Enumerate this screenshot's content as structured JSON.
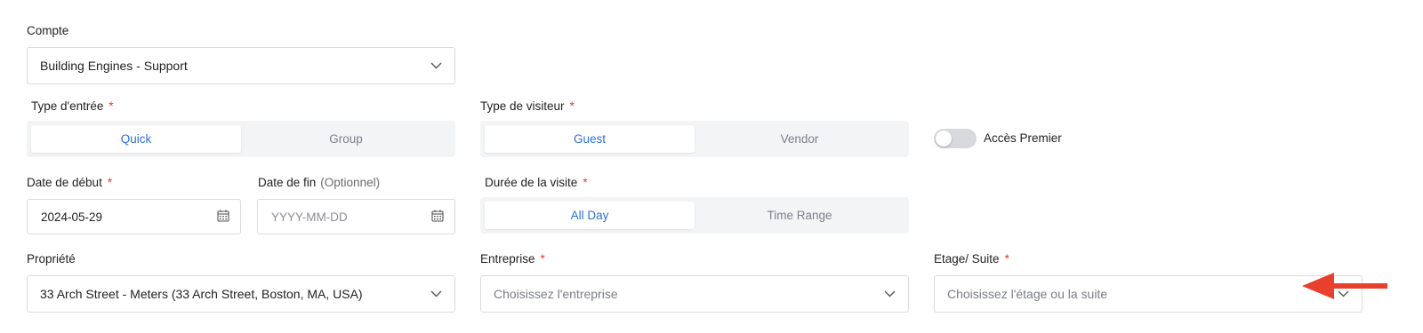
{
  "compte": {
    "label": "Compte",
    "value": "Building Engines - Support"
  },
  "type_entree": {
    "label": "Type d'entrée",
    "required_mark": "*",
    "options": [
      "Quick",
      "Group"
    ],
    "selected": "Quick"
  },
  "type_visiteur": {
    "label": "Type de visiteur",
    "required_mark": "*",
    "options": [
      "Guest",
      "Vendor"
    ],
    "selected": "Guest"
  },
  "acces_premier": {
    "label": "Accès Premier",
    "enabled": false
  },
  "date_debut": {
    "label": "Date de début",
    "required_mark": "*",
    "value": "2024-05-29"
  },
  "date_fin": {
    "label": "Date de fin",
    "optional_text": "(Optionnel)",
    "placeholder": "YYYY-MM-DD"
  },
  "duree_visite": {
    "label": "Durée de la visite",
    "required_mark": "*",
    "options": [
      "All Day",
      "Time Range"
    ],
    "selected": "All Day"
  },
  "propriete": {
    "label": "Propriété",
    "value": "33 Arch Street - Meters (33 Arch Street, Boston, MA, USA)"
  },
  "entreprise": {
    "label": "Entreprise",
    "required_mark": "*",
    "placeholder": "Choisissez l'entreprise"
  },
  "etage_suite": {
    "label": "Etage/ Suite",
    "required_mark": "*",
    "placeholder": "Choisissez l'étage ou la suite"
  },
  "colors": {
    "accent": "#2f6fd6",
    "required": "#e53935",
    "annotation_arrow": "#e8402c"
  }
}
